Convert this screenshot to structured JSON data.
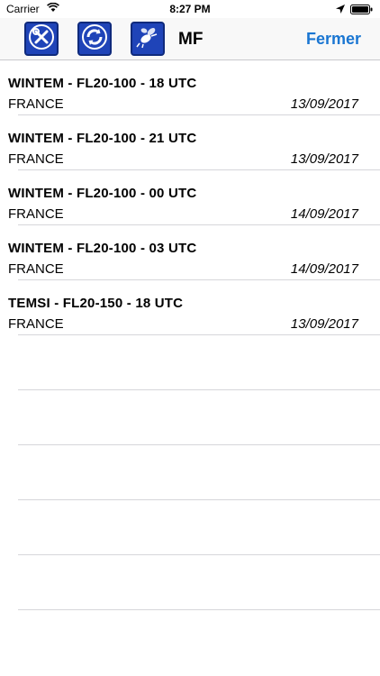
{
  "status_bar": {
    "carrier": "Carrier",
    "time": "8:27 PM"
  },
  "nav": {
    "tools": [
      {
        "icon": "wrench-screwdriver-icon"
      },
      {
        "icon": "refresh-icon"
      },
      {
        "icon": "bee-icon"
      }
    ],
    "title": "MF",
    "close_label": "Fermer",
    "accent_color": "#1a76d2",
    "tool_color": "#1f44b8"
  },
  "items": [
    {
      "title": "WINTEM - FL20-100 - 18 UTC",
      "region": "FRANCE",
      "date": "13/09/2017"
    },
    {
      "title": "WINTEM - FL20-100 - 21 UTC",
      "region": "FRANCE",
      "date": "13/09/2017"
    },
    {
      "title": "WINTEM - FL20-100 - 00 UTC",
      "region": "FRANCE",
      "date": "14/09/2017"
    },
    {
      "title": "WINTEM - FL20-100 - 03 UTC",
      "region": "FRANCE",
      "date": "14/09/2017"
    },
    {
      "title": "TEMSI - FL20-150 - 18 UTC",
      "region": "FRANCE",
      "date": "13/09/2017"
    }
  ]
}
